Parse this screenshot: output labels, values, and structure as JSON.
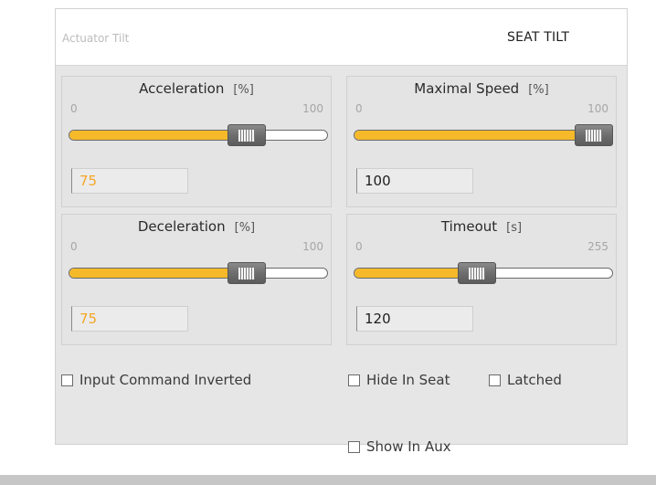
{
  "header": {
    "subtitle": "Actuator Tilt",
    "title": "SEAT TILT"
  },
  "groups": {
    "acceleration": {
      "title": "Acceleration",
      "unit": "[%]",
      "min": "0",
      "max": "100",
      "value": "75",
      "fraction": 0.72
    },
    "max_speed": {
      "title": "Maximal Speed",
      "unit": "[%]",
      "min": "0",
      "max": "100",
      "value": "100",
      "fraction": 1.0
    },
    "deceleration": {
      "title": "Deceleration",
      "unit": "[%]",
      "min": "0",
      "max": "100",
      "value": "75",
      "fraction": 0.72
    },
    "timeout": {
      "title": "Timeout",
      "unit": "[s]",
      "min": "0",
      "max": "255",
      "value": "120",
      "fraction": 0.47
    }
  },
  "checkboxes": {
    "input_inverted": "Input Command Inverted",
    "hide_in_seat": "Hide In Seat",
    "latched": "Latched",
    "show_in_aux": "Show In Aux"
  },
  "colors": {
    "slider_fill": "#f5b929",
    "highlight_value": "#f5a623",
    "panel_background": "#e6e6e6"
  }
}
